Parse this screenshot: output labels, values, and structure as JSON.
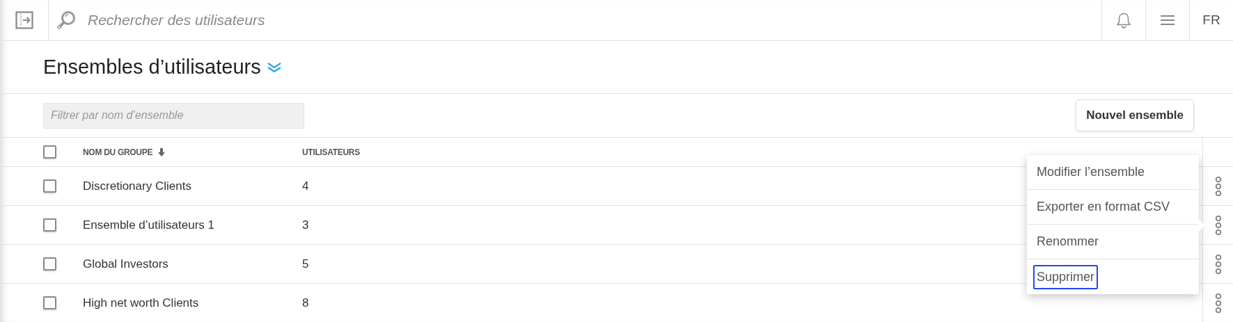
{
  "topbar": {
    "search": {
      "placeholder": "Rechercher des utilisateurs"
    },
    "language": "FR"
  },
  "title": "Ensembles d’utilisateurs",
  "filter": {
    "placeholder": "Filtrer par nom d’ensemble"
  },
  "new_button": "Nouvel ensemble",
  "table": {
    "select_all": {
      "checked": false
    },
    "columns": [
      {
        "label": "NOM DU GROUPE",
        "sorted": true
      },
      {
        "label": "UTILISATEURS",
        "sorted": false
      }
    ],
    "rows": [
      {
        "name": "Discretionary Clients",
        "users": "4",
        "checked": false,
        "menu_open": false
      },
      {
        "name": "Ensemble d’utilisateurs 1",
        "users": "3",
        "checked": false,
        "menu_open": true
      },
      {
        "name": "Global Investors",
        "users": "5",
        "checked": false,
        "menu_open": false
      },
      {
        "name": "High net worth Clients",
        "users": "8",
        "checked": false,
        "menu_open": false
      }
    ]
  },
  "context_menu": [
    {
      "label": "Modifier l’ensemble",
      "focused": false
    },
    {
      "label": "Exporter en format CSV",
      "focused": false
    },
    {
      "label": "Renommer",
      "focused": false
    },
    {
      "label": "Supprimer",
      "focused": true
    }
  ]
}
